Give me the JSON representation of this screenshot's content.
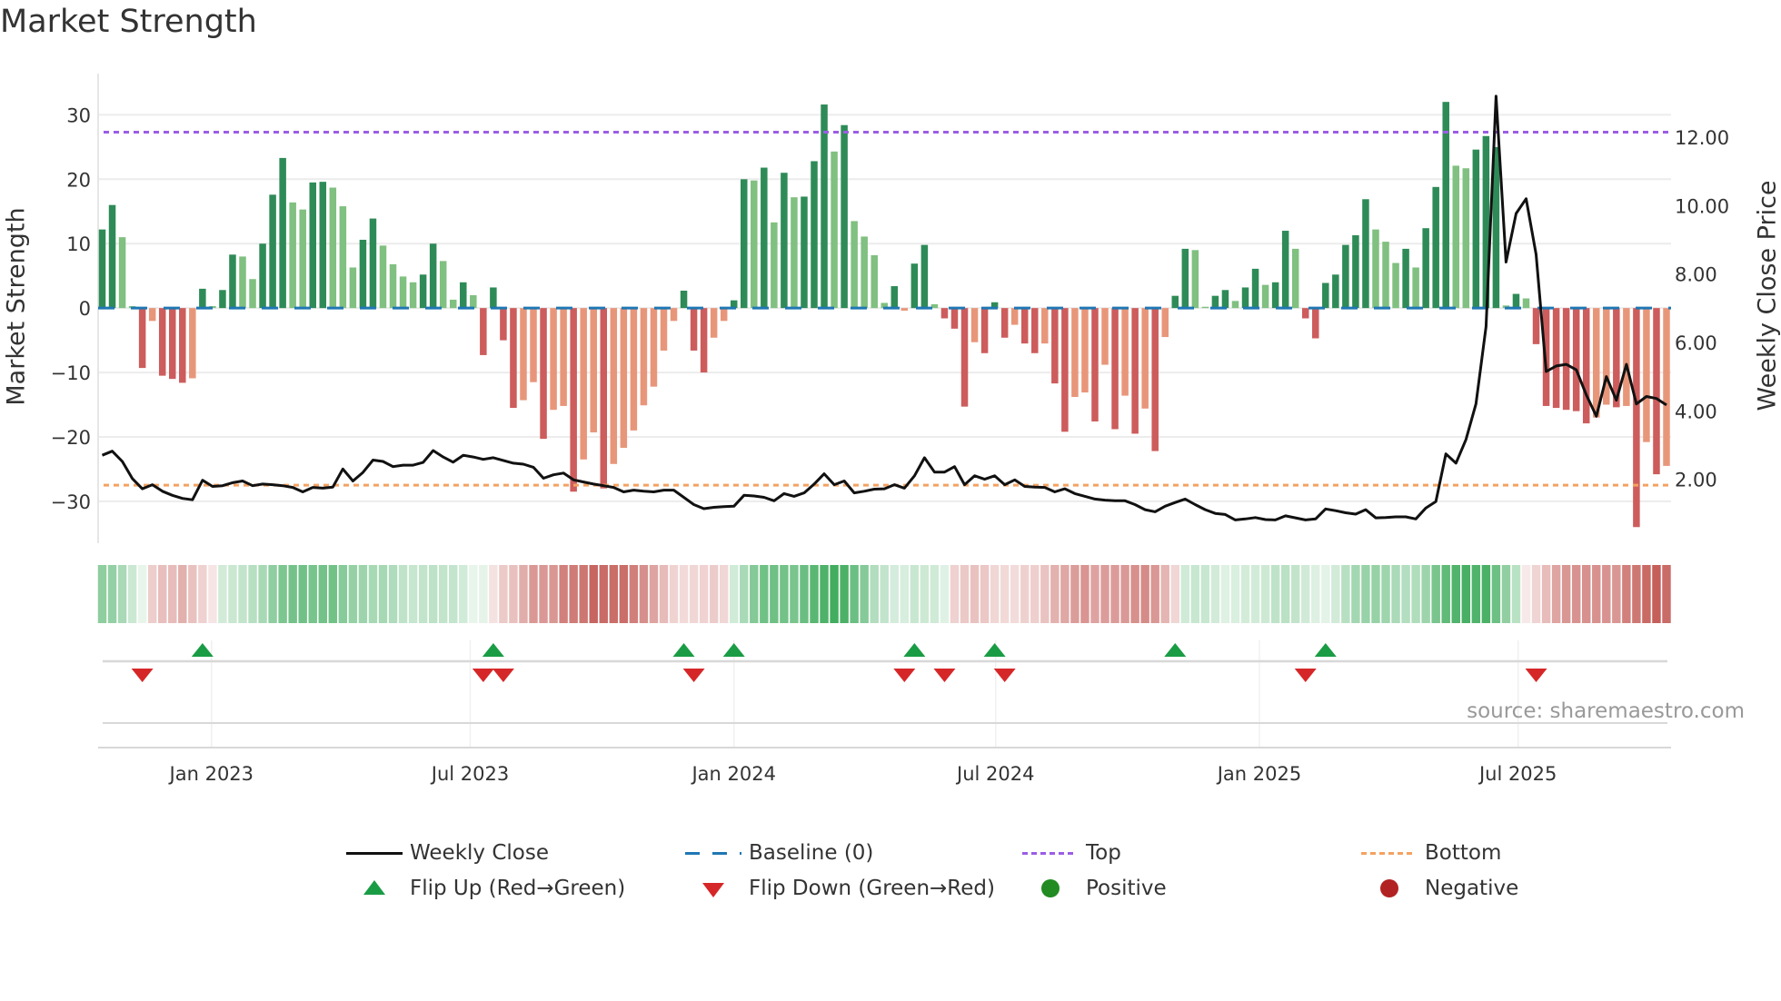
{
  "title": "Market Strength",
  "source": "source: sharemaestro.com",
  "legend": {
    "weekly_close": "Weekly Close",
    "baseline": "Baseline (0)",
    "top": "Top",
    "bottom": "Bottom",
    "flip_up": "Flip Up (Red→Green)",
    "flip_down": "Flip Down (Green→Red)",
    "positive": "Positive",
    "negative": "Negative"
  },
  "colors": {
    "strong_up": "#2e8b57",
    "weak_up": "#80c080",
    "strong_down": "#cd5c5c",
    "weak_down": "#e8967a",
    "baseline": "#1f77b4",
    "top": "#9b5de5",
    "bottom": "#f4a261",
    "price": "#111111",
    "flip_up": "#1a9c45",
    "flip_down": "#d62728",
    "positive": "#228b22",
    "negative": "#b22222"
  },
  "chart_data": {
    "type": "bar",
    "title": "Market Strength",
    "ylabel": "Market Strength",
    "y2label": "Weekly Close Price",
    "ylim": [
      -36.5,
      36.4
    ],
    "y2lim": [
      0.13,
      13.86
    ],
    "yticks": [
      "30",
      "20",
      "10",
      "0",
      "−10",
      "−20",
      "−30"
    ],
    "ytick_values": [
      30,
      20,
      10,
      0,
      -10,
      -20,
      -30
    ],
    "y2ticks": [
      "12.00",
      "10.00",
      "8.00",
      "6.00",
      "4.00",
      "2.00"
    ],
    "y2tick_values": [
      12,
      10,
      8,
      6,
      4,
      2
    ],
    "top_level": 27.3,
    "bottom_level": -27.5,
    "baseline": 0,
    "xticks": [
      "Jan 2023",
      "Jul 2023",
      "Jan 2024",
      "Jul 2024",
      "Jan 2025",
      "Jul 2025"
    ],
    "xtick_week_index": [
      10.9,
      36.7,
      63.0,
      89.1,
      115.4,
      141.2
    ],
    "strength": [
      12.2,
      16,
      11,
      0.3,
      -9.3,
      -2,
      -10.5,
      -11,
      -11.6,
      -10.9,
      3,
      0.3,
      2.8,
      8.3,
      8,
      4.5,
      10,
      17.6,
      23.3,
      16.4,
      15.3,
      19.5,
      19.6,
      18.7,
      15.8,
      6.3,
      10.6,
      13.9,
      9.7,
      6.8,
      4.9,
      4,
      5.2,
      10,
      7.3,
      1.3,
      4,
      2,
      -7.3,
      3.2,
      -5,
      -15.5,
      -14.3,
      -11.5,
      -20.3,
      -15.8,
      -15.2,
      -28.5,
      -23.5,
      -19.3,
      -28,
      -24.2,
      -21.7,
      -19,
      -15.1,
      -12.2,
      -6.6,
      -2,
      2.7,
      -6.6,
      -10,
      -4.6,
      -2,
      1.2,
      20,
      19.8,
      21.8,
      13.3,
      21,
      17.2,
      17.3,
      22.8,
      31.6,
      24.3,
      28.4,
      13.5,
      11.1,
      8.2,
      0.8,
      3.4,
      -0.4,
      6.9,
      9.8,
      0.6,
      -1.6,
      -3.2,
      -15.3,
      -5.3,
      -7,
      0.9,
      -4.6,
      -2.6,
      -5.5,
      -7,
      -5.5,
      -11.7,
      -19.2,
      -13.8,
      -13.1,
      -17.6,
      -8.8,
      -18.8,
      -13.6,
      -19.5,
      -15.6,
      -22.2,
      -4.5,
      1.9,
      9.2,
      9,
      0.2,
      1.9,
      2.8,
      1.1,
      3.2,
      6.1,
      3.6,
      4,
      12,
      9.2,
      -1.6,
      -4.7,
      3.9,
      5.2,
      9.8,
      11.3,
      16.9,
      12.2,
      10.3,
      7,
      9.2,
      6.3,
      12.4,
      18.8,
      32,
      22.1,
      21.7,
      24.6,
      26.7,
      25,
      0.4,
      2.2,
      1.5,
      -5.6,
      -15.2,
      -15.5,
      -15.8,
      -16,
      -17.9,
      -17,
      -15,
      -15.4,
      -15.2,
      -34,
      -20.8,
      -25.8,
      -24.5
    ],
    "strong": [
      1,
      1,
      0,
      0,
      1,
      0,
      1,
      1,
      1,
      0,
      1,
      0,
      1,
      1,
      0,
      0,
      1,
      1,
      1,
      0,
      0,
      1,
      1,
      0,
      0,
      0,
      1,
      1,
      0,
      0,
      0,
      0,
      1,
      1,
      0,
      0,
      1,
      0,
      1,
      1,
      1,
      1,
      0,
      0,
      1,
      0,
      0,
      1,
      0,
      0,
      1,
      0,
      0,
      0,
      0,
      0,
      0,
      0,
      1,
      1,
      1,
      0,
      0,
      1,
      1,
      0,
      1,
      0,
      1,
      0,
      1,
      1,
      1,
      0,
      1,
      0,
      0,
      0,
      0,
      1,
      0,
      1,
      1,
      0,
      1,
      1,
      1,
      0,
      1,
      1,
      1,
      0,
      1,
      1,
      0,
      1,
      1,
      0,
      0,
      1,
      0,
      1,
      0,
      1,
      0,
      1,
      0,
      1,
      1,
      0,
      0,
      1,
      1,
      0,
      1,
      1,
      0,
      1,
      1,
      0,
      1,
      1,
      1,
      1,
      1,
      1,
      1,
      0,
      0,
      0,
      1,
      0,
      1,
      1,
      1,
      0,
      0,
      1,
      1,
      1,
      0,
      1,
      0,
      1,
      1,
      1,
      1,
      1,
      1,
      0,
      0,
      1,
      0,
      1,
      0,
      1,
      0
    ],
    "weekly_close": [
      2.7,
      2.82,
      2.52,
      2.02,
      1.72,
      1.84,
      1.65,
      1.53,
      1.44,
      1.4,
      1.97,
      1.79,
      1.81,
      1.9,
      1.95,
      1.81,
      1.86,
      1.84,
      1.81,
      1.76,
      1.63,
      1.76,
      1.74,
      1.77,
      2.3,
      1.95,
      2.2,
      2.56,
      2.52,
      2.37,
      2.41,
      2.41,
      2.49,
      2.84,
      2.65,
      2.5,
      2.7,
      2.65,
      2.58,
      2.63,
      2.55,
      2.47,
      2.44,
      2.35,
      2.03,
      2.13,
      2.18,
      1.98,
      1.92,
      1.86,
      1.81,
      1.76,
      1.63,
      1.68,
      1.65,
      1.63,
      1.68,
      1.68,
      1.47,
      1.26,
      1.14,
      1.18,
      1.2,
      1.21,
      1.53,
      1.51,
      1.47,
      1.37,
      1.58,
      1.5,
      1.6,
      1.86,
      2.16,
      1.84,
      1.95,
      1.6,
      1.65,
      1.71,
      1.72,
      1.84,
      1.74,
      2.1,
      2.63,
      2.21,
      2.21,
      2.37,
      1.84,
      2.1,
      2,
      2.1,
      1.84,
      1.98,
      1.79,
      1.77,
      1.76,
      1.63,
      1.72,
      1.58,
      1.5,
      1.42,
      1.39,
      1.37,
      1.37,
      1.26,
      1.11,
      1.05,
      1.21,
      1.32,
      1.42,
      1.26,
      1.11,
      1,
      0.97,
      0.81,
      0.84,
      0.88,
      0.82,
      0.81,
      0.93,
      0.87,
      0.81,
      0.84,
      1.13,
      1.08,
      1.02,
      0.98,
      1.11,
      0.87,
      0.88,
      0.9,
      0.9,
      0.84,
      1.16,
      1.35,
      2.74,
      2.47,
      3.16,
      4.2,
      6.46,
      13.2,
      8.35,
      9.77,
      10.2,
      8.57,
      5.15,
      5.31,
      5.36,
      5.2,
      4.47,
      3.84,
      5,
      4.31,
      5.36,
      4.2,
      4.42,
      4.36,
      4.17
    ],
    "flip_up_weeks": [
      10,
      39,
      58,
      63,
      81,
      89,
      107,
      122
    ],
    "flip_down_weeks": [
      4,
      38,
      40,
      59,
      80,
      84,
      90,
      120,
      143
    ]
  }
}
